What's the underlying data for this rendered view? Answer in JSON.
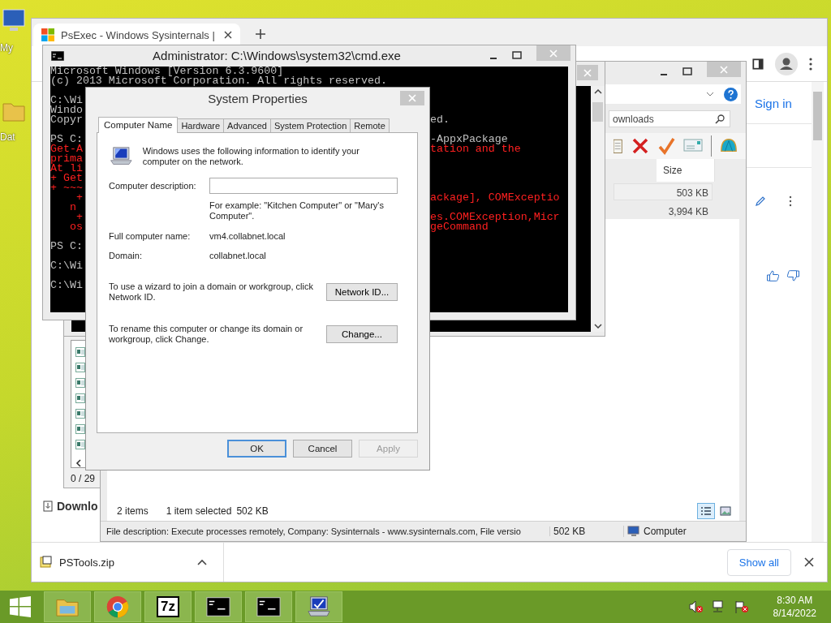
{
  "desktop": {
    "icons": [
      {
        "label": "My",
        "kind": "computer"
      },
      {
        "label": "Dat",
        "kind": "folder"
      }
    ]
  },
  "browser": {
    "tab": {
      "title": "PsExec - Windows Sysinternals |",
      "selected": true
    },
    "sign_in": "Sign in",
    "page_button": "Downlo",
    "download": {
      "file": "PSTools.zip"
    },
    "show_all": "Show all"
  },
  "list_window": {
    "status": "0 / 29"
  },
  "explorer": {
    "search_value": "ownloads",
    "column": "Size",
    "rows": [
      {
        "size": "503 KB",
        "selected": true
      },
      {
        "size": "3,994 KB",
        "selected": false
      }
    ],
    "status": {
      "items": "2 items",
      "selection": "1 item selected",
      "selection_size": "502 KB"
    },
    "view_modes": [
      {
        "kind": "details",
        "selected": true
      },
      {
        "kind": "preview",
        "selected": false
      }
    ],
    "details": {
      "description": "File description: Execute processes remotely, Company: Sysinternals - www.sysinternals.com, File versio",
      "size": "502 KB",
      "location": "Computer"
    }
  },
  "console": {
    "title": "Administrator: C:\\Windows\\system32\\cmd.exe",
    "lines": [
      {
        "kind": "output",
        "left": "Microsoft Windows [Version 6.3.9600]"
      },
      {
        "kind": "output",
        "left": "(c) 2013 Microsoft Corporation. All rights reserved."
      },
      {
        "kind": "blank"
      },
      {
        "kind": "output",
        "left": "C:\\Wi"
      },
      {
        "kind": "output",
        "left": "Windo"
      },
      {
        "kind": "output",
        "left": "Copyr",
        "right": "ed."
      },
      {
        "kind": "blank"
      },
      {
        "kind": "output",
        "left": "PS C:",
        "right": "-AppxPackage"
      },
      {
        "kind": "error",
        "left": "Get-A",
        "right": "tation and the"
      },
      {
        "kind": "error",
        "left": "prima"
      },
      {
        "kind": "error",
        "left": "At li"
      },
      {
        "kind": "error",
        "left": "+ Get"
      },
      {
        "kind": "error",
        "left": "+ ~~~"
      },
      {
        "kind": "error",
        "left": "    +",
        "right": "ackage], COMExceptio"
      },
      {
        "kind": "error",
        "left": "   n"
      },
      {
        "kind": "error",
        "left": "    +",
        "right": "es.COMException,Micr"
      },
      {
        "kind": "error",
        "left": "   os",
        "right": "geCommand"
      },
      {
        "kind": "blank"
      },
      {
        "kind": "output",
        "left": "PS C:"
      },
      {
        "kind": "blank"
      },
      {
        "kind": "output",
        "left": "C:\\Wi"
      },
      {
        "kind": "blank"
      },
      {
        "kind": "output",
        "left": "C:\\Wi"
      }
    ]
  },
  "dialog": {
    "title": "System Properties",
    "tabs": [
      {
        "label": "Computer Name",
        "selected": true
      },
      {
        "label": "Hardware",
        "selected": false
      },
      {
        "label": "Advanced",
        "selected": false
      },
      {
        "label": "System Protection",
        "selected": false
      },
      {
        "label": "Remote",
        "selected": false
      }
    ],
    "intro": "Windows uses the following information to identify your computer on the network.",
    "fields": [
      {
        "kind": "input",
        "label": "Computer description:",
        "note": "For example: \"Kitchen Computer\" or \"Mary's Computer\"."
      },
      {
        "kind": "value",
        "label": "Full computer name:",
        "value": "vm4.collabnet.local"
      },
      {
        "kind": "value",
        "label": "Domain:",
        "value": "collabnet.local"
      }
    ],
    "actions": [
      {
        "text": "To use a wizard to join a domain or workgroup, click Network ID.",
        "button": "Network ID..."
      },
      {
        "text": "To rename this computer or change its domain or workgroup, click Change.",
        "button": "Change..."
      }
    ],
    "buttons": [
      {
        "label": "OK",
        "default": true,
        "disabled": false
      },
      {
        "label": "Cancel",
        "default": false,
        "disabled": false
      },
      {
        "label": "Apply",
        "default": false,
        "disabled": true
      }
    ]
  },
  "taskbar": {
    "apps": [
      {
        "kind": "explorer"
      },
      {
        "kind": "chrome"
      },
      {
        "kind": "archiver",
        "label": "7z"
      },
      {
        "kind": "console"
      },
      {
        "kind": "console"
      },
      {
        "kind": "system"
      }
    ],
    "clock": {
      "time": "8:30 AM",
      "date": "8/14/2022"
    }
  }
}
